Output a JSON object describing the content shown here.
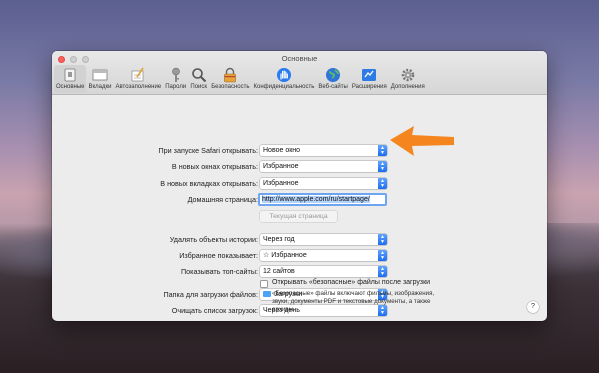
{
  "window": {
    "title": "Основные"
  },
  "toolbar": {
    "tabs": [
      {
        "label": "Основные",
        "icon": "general-icon"
      },
      {
        "label": "Вкладки",
        "icon": "tabs-icon"
      },
      {
        "label": "Автозаполнение",
        "icon": "autofill-icon"
      },
      {
        "label": "Пароли",
        "icon": "key-icon"
      },
      {
        "label": "Поиск",
        "icon": "search-icon"
      },
      {
        "label": "Безопасность",
        "icon": "lock-icon"
      },
      {
        "label": "Конфиденциальность",
        "icon": "hand-icon"
      },
      {
        "label": "Веб-сайты",
        "icon": "globe-icon"
      },
      {
        "label": "Расширения",
        "icon": "puzzle-icon"
      },
      {
        "label": "Дополнения",
        "icon": "gear-icon"
      }
    ]
  },
  "settings": {
    "safari_opens_with": {
      "label": "При запуске Safari открывать:",
      "value": "Новое окно"
    },
    "new_windows_open_with": {
      "label": "В новых окнах открывать:",
      "value": "Избранное"
    },
    "new_tabs_open_with": {
      "label": "В новых вкладках открывать:",
      "value": "Избранное"
    },
    "homepage": {
      "label": "Домашняя страница:",
      "value": "http://www.apple.com/ru/startpage/"
    },
    "set_current_page": {
      "label": "Текущая страница"
    },
    "remove_history": {
      "label": "Удалять объекты истории:",
      "value": "Через год"
    },
    "favorites_shows": {
      "label": "Избранное показывает:",
      "value": "Избранное"
    },
    "top_sites_shows": {
      "label": "Показывать топ-сайты:",
      "value": "12 сайтов"
    },
    "download_location": {
      "label": "Папка для загрузки файлов:",
      "value": "Загрузки"
    },
    "remove_download_items": {
      "label": "Очищать список загрузок:",
      "value": "Через день"
    },
    "open_safe_files": {
      "label": "Открывать «безопасные» файлы после загрузки",
      "checked": false,
      "note": "«Безопасные» файлы включают фильмы, изображения, звуки, документы PDF и текстовые документы, а также архивы."
    }
  },
  "help": {
    "label": "?"
  },
  "colors": {
    "accent": "#1d6ff2",
    "annotation_arrow": "#f5861f"
  }
}
